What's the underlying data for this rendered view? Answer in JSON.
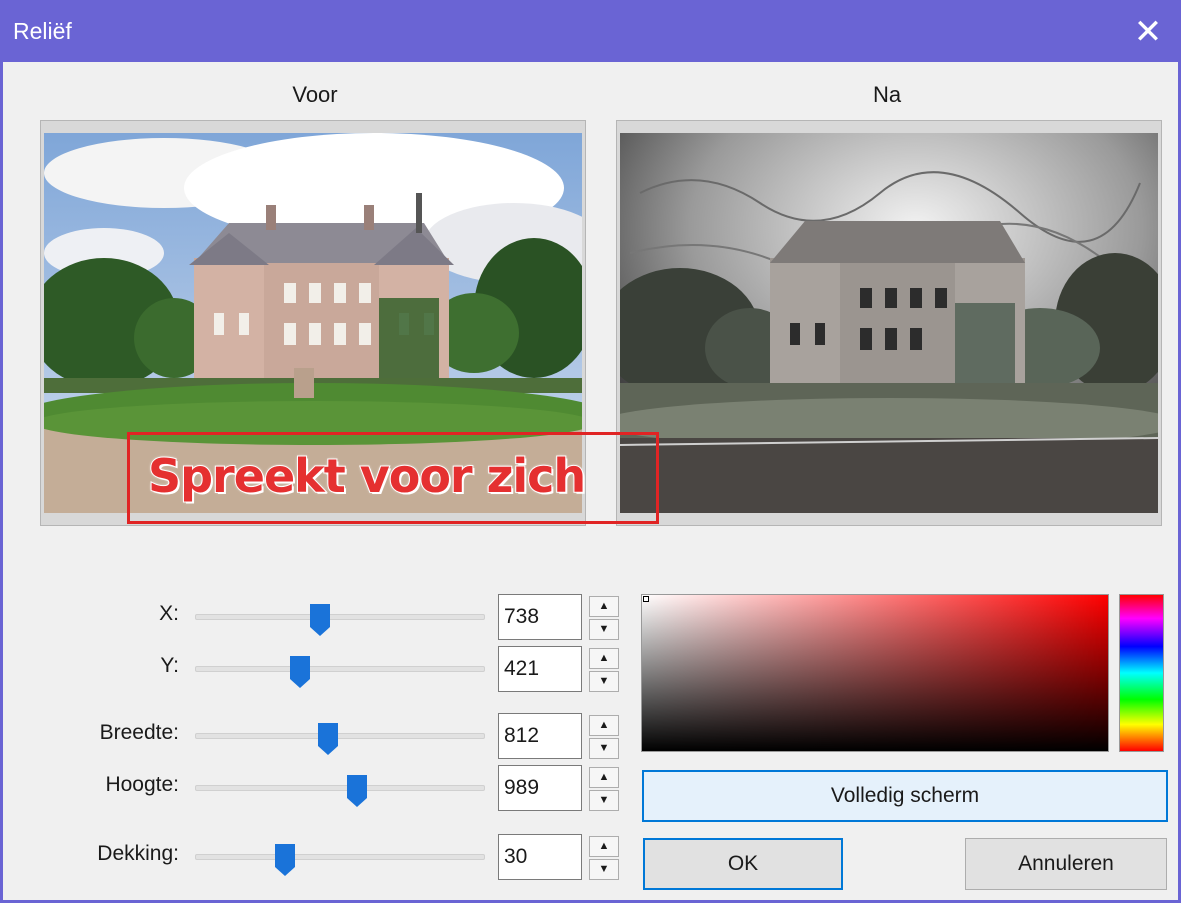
{
  "window": {
    "title": "Reliëf",
    "close_glyph": "✕"
  },
  "preview": {
    "before_label": "Voor",
    "after_label": "Na"
  },
  "annotation": {
    "text": "Spreekt voor zich",
    "color": "#e02424"
  },
  "sliders": [
    {
      "label": "X:",
      "value": "738",
      "position": 0.43
    },
    {
      "label": "Y:",
      "value": "421",
      "position": 0.36
    },
    {
      "label": "Breedte:",
      "value": "812",
      "position": 0.46
    },
    {
      "label": "Hoogte:",
      "value": "989",
      "position": 0.56
    },
    {
      "label": "Dekking:",
      "value": "30",
      "position": 0.31
    }
  ],
  "color_picker": {
    "base_hue": "#ff0000"
  },
  "buttons": {
    "fullscreen": "Volledig scherm",
    "ok": "OK",
    "cancel": "Annuleren"
  },
  "colors": {
    "titlebar": "#6a64d4",
    "accent": "#0078d7",
    "thumb": "#1a73d9"
  }
}
